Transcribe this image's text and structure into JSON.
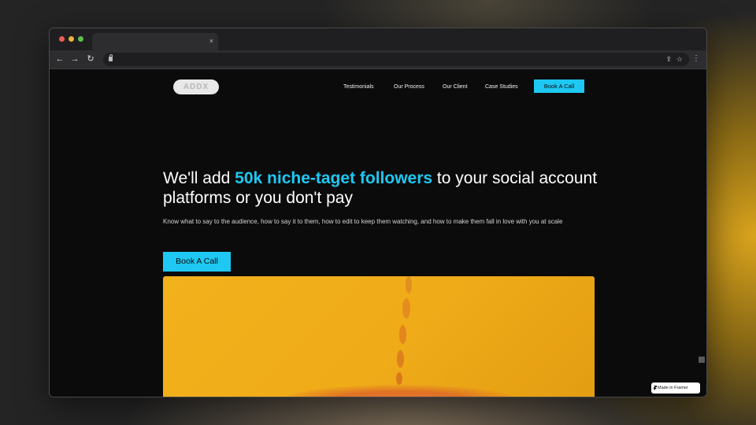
{
  "browser": {
    "tab_close": "×",
    "nav": {
      "back": "←",
      "forward": "→",
      "reload": "↻"
    },
    "address_icons": {
      "share": "⇪",
      "bookmark": "☆",
      "menu": "⋮"
    }
  },
  "site": {
    "logo_text": "ADDX",
    "nav_links": [
      "Testimonials",
      "Our Process",
      "Our Client",
      "Case Studies"
    ],
    "top_cta": "Book A Call",
    "headline": {
      "pre": "We'll add ",
      "highlight": "50k niche-taget followers",
      "post": " to your social account platforms or you don't pay"
    },
    "subtext": "Know what to say to the audience, how to say it to them, how to edit to keep them watching, and how to make them fall in love with you at scale",
    "main_cta": "Book A Call",
    "framer_badge": "Made in Framer"
  },
  "colors": {
    "accent": "#1ec8f2",
    "hero_image": "#f2b21c",
    "page_bg": "#0b0b0b"
  }
}
